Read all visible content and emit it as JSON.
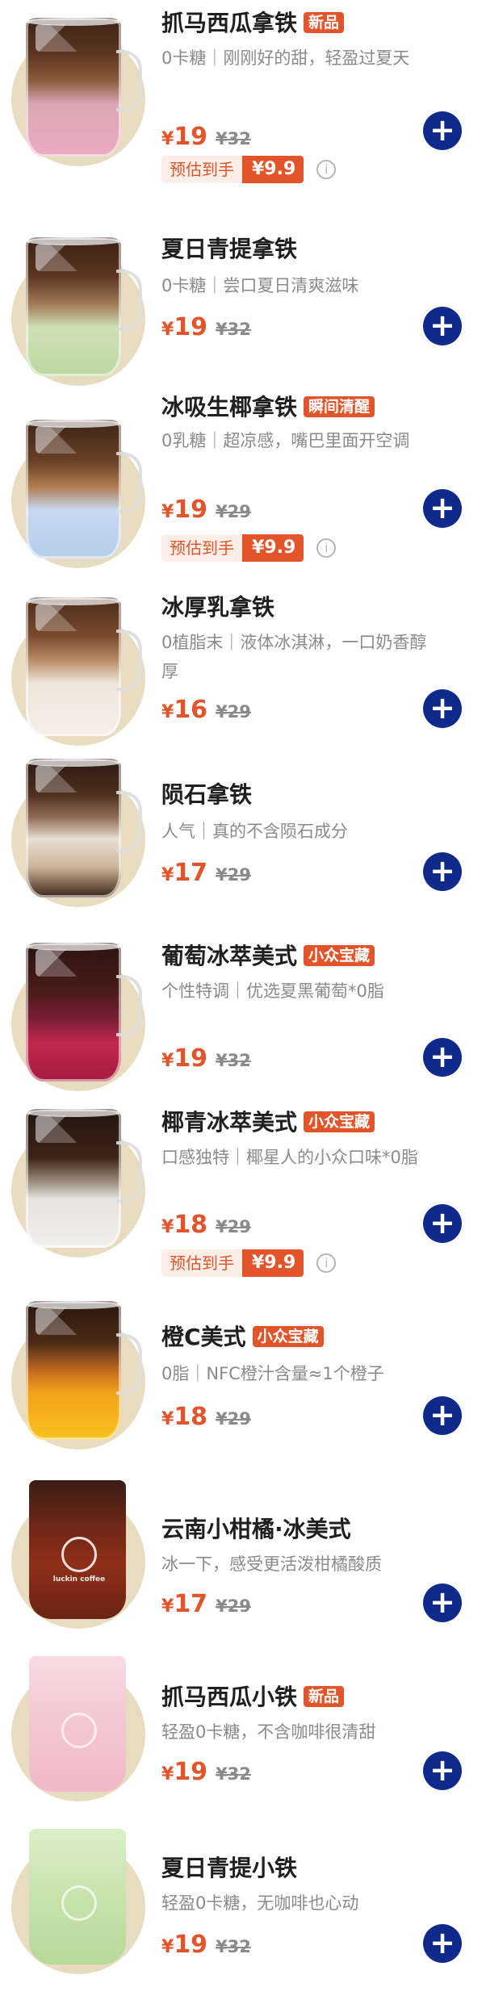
{
  "colors": {
    "accent": "#e2552b",
    "add_button": "#0f2a8a",
    "thumb_bg": "#e8dcc0",
    "promo_bg": "#fdeee7"
  },
  "icons": {
    "add": "plus-icon",
    "info": "info-icon"
  },
  "products": [
    {
      "name": "抓马西瓜拿铁",
      "tag": "新品",
      "desc": "0卡糖｜刚刚好的甜，轻盈过夏天",
      "currency": "¥",
      "price": "19",
      "original": "¥32",
      "promo_label": "预估到手",
      "promo_value": "¥9.9",
      "add_label": "+",
      "info_label": "i"
    },
    {
      "name": "夏日青提拿铁",
      "desc": "0卡糖｜尝口夏日清爽滋味",
      "currency": "¥",
      "price": "19",
      "original": "¥32",
      "add_label": "+"
    },
    {
      "name": "冰吸生椰拿铁",
      "tag": "瞬间清醒",
      "desc": "0乳糖｜超凉感，嘴巴里面开空调",
      "currency": "¥",
      "price": "19",
      "original": "¥29",
      "promo_label": "预估到手",
      "promo_value": "¥9.9",
      "add_label": "+",
      "info_label": "i"
    },
    {
      "name": "冰厚乳拿铁",
      "desc": "0植脂末｜液体冰淇淋，一口奶香醇厚",
      "currency": "¥",
      "price": "16",
      "original": "¥29",
      "add_label": "+"
    },
    {
      "name": "陨石拿铁",
      "desc": "人气｜真的不含陨石成分",
      "currency": "¥",
      "price": "17",
      "original": "¥29",
      "add_label": "+"
    },
    {
      "name": "葡萄冰萃美式",
      "tag": "小众宝藏",
      "desc": "个性特调｜优选夏黑葡萄*0脂",
      "currency": "¥",
      "price": "19",
      "original": "¥32",
      "add_label": "+"
    },
    {
      "name": "椰青冰萃美式",
      "tag": "小众宝藏",
      "desc": "口感独特｜椰星人的小众口味*0脂",
      "currency": "¥",
      "price": "18",
      "original": "¥29",
      "promo_label": "预估到手",
      "promo_value": "¥9.9",
      "add_label": "+",
      "info_label": "i"
    },
    {
      "name": "橙C美式",
      "tag": "小众宝藏",
      "desc": "0脂｜NFC橙汁含量≈1个橙子",
      "currency": "¥",
      "price": "18",
      "original": "¥29",
      "add_label": "+"
    },
    {
      "name": "云南小柑橘·冰美式",
      "desc": "冰一下，感受更活泼柑橘酸质",
      "currency": "¥",
      "price": "17",
      "original": "¥29",
      "add_label": "+",
      "cup_logo": "luckin coffee"
    },
    {
      "name": "抓马西瓜小铁",
      "tag": "新品",
      "desc": "轻盈0卡糖，不含咖啡很清甜",
      "currency": "¥",
      "price": "19",
      "original": "¥32",
      "add_label": "+"
    },
    {
      "name": "夏日青提小铁",
      "desc": "轻盈0卡糖，无咖啡也心动",
      "currency": "¥",
      "price": "19",
      "original": "¥32",
      "add_label": "+"
    }
  ]
}
